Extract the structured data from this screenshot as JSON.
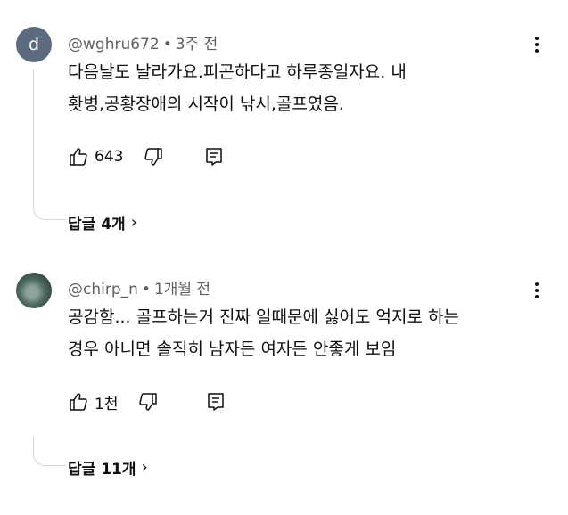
{
  "comments": [
    {
      "avatar_letter": "d",
      "author": "@wghru672",
      "separator": "•",
      "time": "3주 전",
      "text_lines": [
        "다음날도 날라가요.피곤하다고 하루종일자요. 내",
        "홧병,공황장애의 시작이 낚시,골프였음."
      ],
      "likes": "643",
      "replies_label": "답글 4개",
      "replies_chevron": "›"
    },
    {
      "avatar_letter": "",
      "author": "@chirp_n",
      "separator": "•",
      "time": "1개월 전",
      "text_lines": [
        "공감함... 골프하는거 진짜 일때문에 싫어도 억지로 하는",
        "경우 아니면 솔직히 남자든 여자든 안좋게 보임"
      ],
      "likes": "1천",
      "replies_label": "답글 11개",
      "replies_chevron": "›"
    }
  ],
  "icons": {
    "like": "thumbs-up-icon",
    "dislike": "thumbs-down-icon",
    "reply": "reply-comment-icon",
    "menu": "more-vert-icon"
  }
}
